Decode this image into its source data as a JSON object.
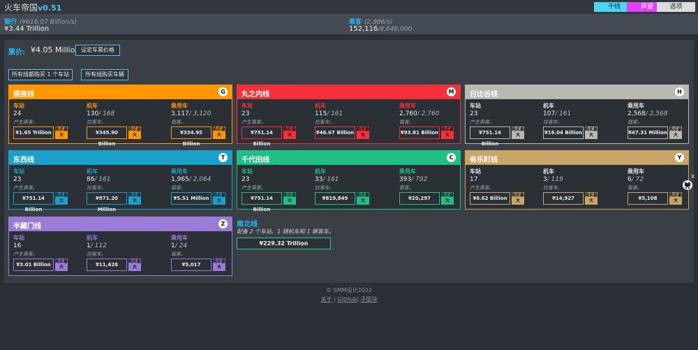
{
  "app": {
    "title": "火车帝国",
    "version": "v0.51"
  },
  "topbuttons": {
    "lines": "干线",
    "fame": "声望",
    "options": "选项"
  },
  "bank": {
    "label": "银行",
    "rate": "(¥616.07 Billion/s)",
    "value": "¥3.44 Trillion"
  },
  "passengers": {
    "label": "乘客",
    "rate": "(2,986/s)",
    "value": "152,116",
    "max": "/8,648,000"
  },
  "fare": {
    "label": "票价:",
    "value": "¥4.05 Million",
    "button": "设定车票价格"
  },
  "bulk": {
    "buy_station": "所有线都购买 1 个车站",
    "buy_cars": "所有线购买车辆"
  },
  "cols": {
    "station": "车站",
    "loco": "机车",
    "car": "乘用车",
    "station_desc": "产生乘客。",
    "loco_desc": "拉客车。",
    "car_desc": "载客。",
    "buy_max": "购买最大"
  },
  "lines": [
    {
      "name": "银座线",
      "badge": "G",
      "color": "#ff9800",
      "station": "24",
      "loco": "130",
      "loco_max": "/ 168",
      "car": "3,117",
      "car_max": "/ 3,120",
      "p_station": "¥1.65 Trillion",
      "p_loco": "¥345.90 Billion",
      "p_car": "¥334.95 Billion"
    },
    {
      "name": "丸之内线",
      "badge": "M",
      "color": "#f5303a",
      "station": "23",
      "loco": "115",
      "loco_max": "/ 161",
      "car": "2,760",
      "car_max": "/ 2,760",
      "p_station": "¥751.14 Billion",
      "p_loco": "¥46.67 Billion",
      "p_car": "¥93.81 Billion"
    },
    {
      "name": "日比谷线",
      "badge": "H",
      "color": "#b9b9b1",
      "station": "23",
      "loco": "107",
      "loco_max": "/ 161",
      "car": "2,568",
      "car_max": "/ 2,568",
      "p_station": "¥751.14 Billion",
      "p_loco": "¥16.04 Billion",
      "p_car": "¥47.31 Million"
    },
    {
      "name": "东西线",
      "badge": "T",
      "color": "#1aa0c9",
      "station": "23",
      "loco": "86",
      "loco_max": "/ 161",
      "car": "1,965",
      "car_max": "/ 2,064",
      "p_station": "¥751.14 Billion",
      "p_loco": "¥971.20 Million",
      "p_car": "¥5.51 Million"
    },
    {
      "name": "千代田线",
      "badge": "C",
      "color": "#1fbf86",
      "station": "23",
      "loco": "33",
      "loco_max": "/ 161",
      "car": "393",
      "car_max": "/ 792",
      "p_station": "¥751.14 Billion",
      "p_loco": "¥819,849",
      "p_car": "¥20,297"
    },
    {
      "name": "有乐町线",
      "badge": "Y",
      "color": "#c9a56a",
      "station": "17",
      "loco": "3",
      "loco_max": "/ 119",
      "car": "6",
      "car_max": "/ 72",
      "p_station": "¥6.62 Billion",
      "p_loco": "¥14,927",
      "p_car": "¥5,108"
    },
    {
      "name": "半藏门线",
      "badge": "Z",
      "color": "#9b7ad8",
      "station": "16",
      "loco": "1",
      "loco_max": "/ 112",
      "car": "1",
      "car_max": "/ 24",
      "p_station": "¥3.01 Billion",
      "p_loco": "¥11,428",
      "p_car": "¥5,017"
    }
  ],
  "nanboku": {
    "title": "南北线",
    "desc": "配备 2 个车站、1 辆机车和 1 辆客车。",
    "price": "¥229.32 Trillion"
  },
  "footer": {
    "copy": "© SMM设计2022",
    "about": "关于",
    "github": "GitHub",
    "chat": "子版块"
  },
  "side": {
    "close": "x"
  }
}
